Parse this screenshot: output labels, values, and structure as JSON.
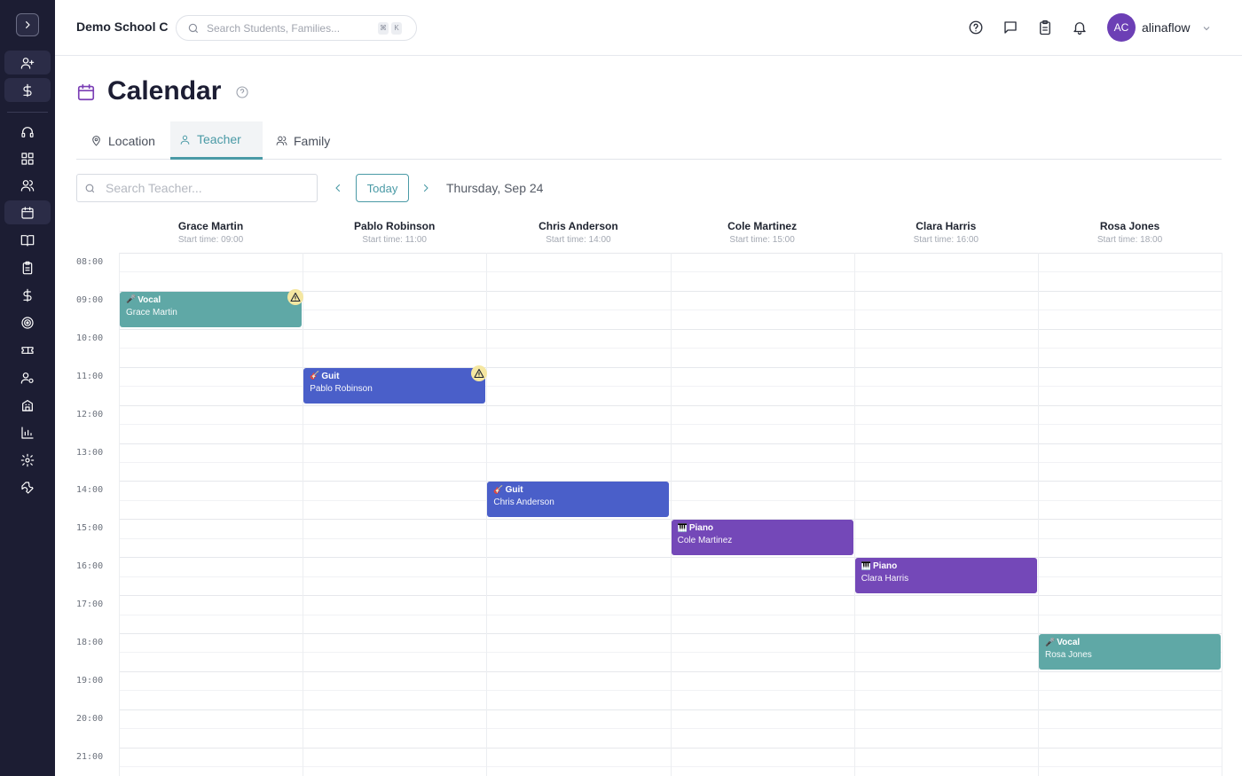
{
  "app": {
    "school_name": "Demo School C",
    "search_placeholder": "Search Students, Families...",
    "kbd_keys": [
      "⌘",
      "K"
    ],
    "user": {
      "initials": "AC",
      "name": "alinaflow",
      "avatar_color": "#6c3fb5"
    }
  },
  "sidebar": {
    "toggle_icon": "chevron-right-icon",
    "items": [
      {
        "name": "add-user-icon"
      },
      {
        "name": "dollar-icon"
      },
      {
        "name": "headset-icon"
      },
      {
        "name": "dashboard-icon"
      },
      {
        "name": "users-icon"
      },
      {
        "name": "calendar-icon",
        "active": true
      },
      {
        "name": "book-icon"
      },
      {
        "name": "clipboard-icon"
      },
      {
        "name": "billing-icon"
      },
      {
        "name": "target-icon"
      },
      {
        "name": "ticket-icon"
      },
      {
        "name": "user-settings-icon"
      },
      {
        "name": "building-icon"
      },
      {
        "name": "chart-icon"
      },
      {
        "name": "settings-icon"
      },
      {
        "name": "wrench-icon"
      }
    ]
  },
  "page": {
    "title": "Calendar",
    "tabs": [
      {
        "label": "Location",
        "icon": "map-pin-icon"
      },
      {
        "label": "Teacher",
        "icon": "user-icon",
        "active": true
      },
      {
        "label": "Family",
        "icon": "users-icon"
      }
    ],
    "teacher_search_placeholder": "Search Teacher...",
    "today_label": "Today",
    "date_label": "Thursday, Sep 24"
  },
  "calendar": {
    "times": [
      "08:00",
      "09:00",
      "10:00",
      "11:00",
      "12:00",
      "13:00",
      "14:00",
      "15:00",
      "16:00",
      "17:00",
      "18:00",
      "19:00",
      "20:00",
      "21:00"
    ],
    "teachers": [
      {
        "name": "Grace Martin",
        "start": "Start time: 09:00"
      },
      {
        "name": "Pablo Robinson",
        "start": "Start time: 11:00"
      },
      {
        "name": "Chris Anderson",
        "start": "Start time: 14:00"
      },
      {
        "name": "Cole Martinez",
        "start": "Start time: 15:00"
      },
      {
        "name": "Clara Harris",
        "start": "Start time: 16:00"
      },
      {
        "name": "Rosa Jones",
        "start": "Start time: 18:00"
      }
    ],
    "events": [
      {
        "emoji": "🎤",
        "title": "Vocal",
        "teacher": "Grace Martin",
        "color": "#5fa8a6",
        "warning": true
      },
      {
        "emoji": "🎸",
        "title": "Guit",
        "teacher": "Pablo Robinson",
        "color": "#4a5fc9",
        "warning": true
      },
      {
        "emoji": "🎸",
        "title": "Guit",
        "teacher": "Chris Anderson",
        "color": "#4a5fc9",
        "warning": false
      },
      {
        "emoji": "🎹",
        "title": "Piano",
        "teacher": "Cole Martinez",
        "color": "#7448b8",
        "warning": false
      },
      {
        "emoji": "🎹",
        "title": "Piano",
        "teacher": "Clara Harris",
        "color": "#7448b8",
        "warning": false
      },
      {
        "emoji": "🎤",
        "title": "Vocal",
        "teacher": "Rosa Jones",
        "color": "#5fa8a6",
        "warning": false
      }
    ]
  },
  "colors": {
    "accent": "#4a9aa6",
    "sidebar_bg": "#1c1d33",
    "title_icon": "#7b3fb5"
  }
}
